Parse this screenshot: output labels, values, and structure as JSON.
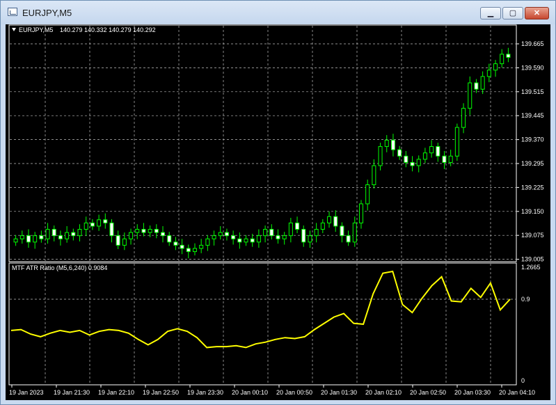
{
  "window": {
    "title": "EURJPY,M5",
    "buttons": {
      "minimize": "▁",
      "maximize": "▢",
      "close": "✕"
    }
  },
  "price_panel": {
    "header_symbol": "EURJPY,M5",
    "header_ohlc": "140.279 140.332 140.279 140.292",
    "price_ticks": [
      "139.665",
      "139.590",
      "139.515",
      "139.445",
      "139.370",
      "139.295",
      "139.225",
      "139.150",
      "139.075",
      "139.005"
    ]
  },
  "indicator_panel": {
    "label": "MTF ATR Ratio  (M5,6,240) 0.9084",
    "ticks": [
      "1.2665",
      "0.9",
      "0"
    ]
  },
  "time_axis": [
    "19 Jan 2023",
    "19 Jan 21:30",
    "19 Jan 22:10",
    "19 Jan 22:50",
    "19 Jan 23:30",
    "20 Jan 00:10",
    "20 Jan 00:50",
    "20 Jan 01:30",
    "20 Jan 02:10",
    "20 Jan 02:50",
    "20 Jan 03:30",
    "20 Jan 04:10"
  ],
  "colors": {
    "background": "#000000",
    "bull_candle": "#000000",
    "bear_candle": "#ffffff",
    "wick": "#00ff00",
    "indicator_line": "#ffff00",
    "grid": "#c0c0c0"
  },
  "chart_data": [
    {
      "type": "candlestick",
      "title": "EURJPY,M5",
      "ylim": [
        139.005,
        139.7
      ],
      "series": [
        {
          "name": "EURJPY,M5",
          "close": [
            139.07,
            139.08,
            139.06,
            139.08,
            139.07,
            139.1,
            139.08,
            139.07,
            139.09,
            139.08,
            139.1,
            139.12,
            139.11,
            139.13,
            139.12,
            139.08,
            139.05,
            139.07,
            139.09,
            139.1,
            139.09,
            139.1,
            139.09,
            139.08,
            139.06,
            139.05,
            139.04,
            139.03,
            139.04,
            139.05,
            139.07,
            139.08,
            139.09,
            139.08,
            139.07,
            139.06,
            139.07,
            139.06,
            139.08,
            139.1,
            139.08,
            139.07,
            139.08,
            139.12,
            139.1,
            139.06,
            139.08,
            139.1,
            139.12,
            139.14,
            139.11,
            139.08,
            139.06,
            139.12,
            139.18,
            139.24,
            139.3,
            139.36,
            139.38,
            139.35,
            139.33,
            139.31,
            139.3,
            139.32,
            139.34,
            139.36,
            139.33,
            139.31,
            139.33,
            139.42,
            139.48,
            139.56,
            139.54,
            139.58,
            139.6,
            139.62,
            139.65,
            139.64
          ]
        }
      ],
      "time_labels": [
        "19 Jan 2023",
        "19 Jan 21:30",
        "19 Jan 22:10",
        "19 Jan 22:50",
        "19 Jan 23:30",
        "20 Jan 00:10",
        "20 Jan 00:50",
        "20 Jan 01:30",
        "20 Jan 02:10",
        "20 Jan 02:50",
        "20 Jan 03:30",
        "20 Jan 04:10"
      ]
    },
    {
      "type": "line",
      "title": "MTF ATR Ratio",
      "ylim": [
        0,
        1.2665
      ],
      "series": [
        {
          "name": "MTF ATR Ratio",
          "values": [
            0.56,
            0.57,
            0.52,
            0.49,
            0.53,
            0.56,
            0.54,
            0.56,
            0.51,
            0.55,
            0.57,
            0.56,
            0.53,
            0.46,
            0.4,
            0.46,
            0.55,
            0.58,
            0.55,
            0.48,
            0.37,
            0.38,
            0.38,
            0.39,
            0.37,
            0.41,
            0.43,
            0.46,
            0.48,
            0.47,
            0.49,
            0.57,
            0.64,
            0.71,
            0.75,
            0.64,
            0.63,
            0.97,
            1.2,
            1.22,
            0.85,
            0.76,
            0.92,
            1.06,
            1.16,
            0.89,
            0.88,
            1.03,
            0.93,
            1.09,
            0.79,
            0.91
          ]
        }
      ]
    }
  ]
}
